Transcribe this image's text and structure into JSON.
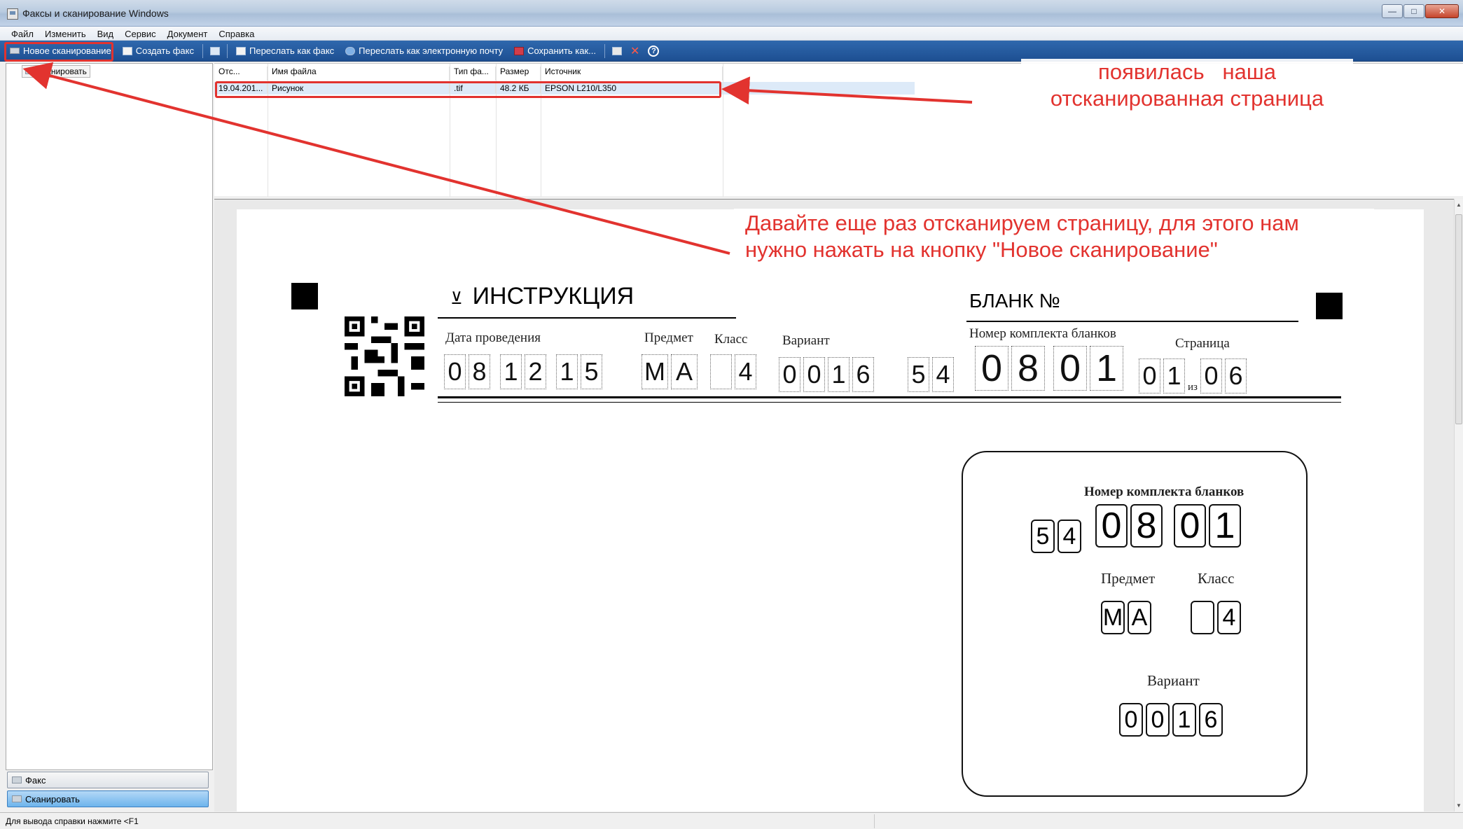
{
  "window": {
    "title": "Факсы и сканирование Windows"
  },
  "menu": [
    "Файл",
    "Изменить",
    "Вид",
    "Сервис",
    "Документ",
    "Справка"
  ],
  "toolbar": {
    "new_scan": "Новое сканирование",
    "new_fax": "Создать факс",
    "forward_fax": "Переслать как факс",
    "forward_email": "Переслать как электронную почту",
    "save_as": "Сохранить как...",
    "help_glyph": "?"
  },
  "sidebar": {
    "tree_item": "Сканировать",
    "nav": [
      {
        "label": "Факс",
        "active": false
      },
      {
        "label": "Сканировать",
        "active": true
      }
    ]
  },
  "list": {
    "columns": [
      "Отс...",
      "Имя файла",
      "Тип фа...",
      "Размер",
      "Источник"
    ],
    "rows": [
      {
        "date": "19.04.201...",
        "name": "Рисунок",
        "type": ".tif",
        "size": "48.2 КБ",
        "source": "EPSON L210/L350"
      }
    ]
  },
  "annotations": {
    "note_top": "появилась наша отсканированная страница",
    "note_top_line1": "появилась   наша",
    "note_top_line2": "отсканированная страница",
    "note_mid_line1": "Давайте еще раз отсканируем страницу, для этого нам",
    "note_mid_line2": "нужно нажать на кнопку \"Новое сканирование\"",
    "color": "#e2332f"
  },
  "form": {
    "heading": "ИНСТРУКЦИЯ",
    "blank_label": "БЛАНК №",
    "date_label": "Дата проведения",
    "subject_label": "Предмет",
    "class_label": "Класс",
    "variant_label": "Вариант",
    "kit_label": "Номер комплекта бланков",
    "page_label": "Страница",
    "of_label": "из",
    "date_digits": [
      "0",
      "8",
      "1",
      "2",
      "1",
      "5"
    ],
    "subject_letters": [
      "М",
      "А"
    ],
    "class_digits": [
      "",
      "4"
    ],
    "variant_digits": [
      "0",
      "0",
      "1",
      "6"
    ],
    "kit_small": [
      "5",
      "4"
    ],
    "kit_big": [
      "0",
      "8",
      "0",
      "1"
    ],
    "page_digits": [
      "0",
      "1"
    ],
    "page_total": [
      "0",
      "6"
    ]
  },
  "status": {
    "text": "Для вывода справки нажмите <F1"
  }
}
